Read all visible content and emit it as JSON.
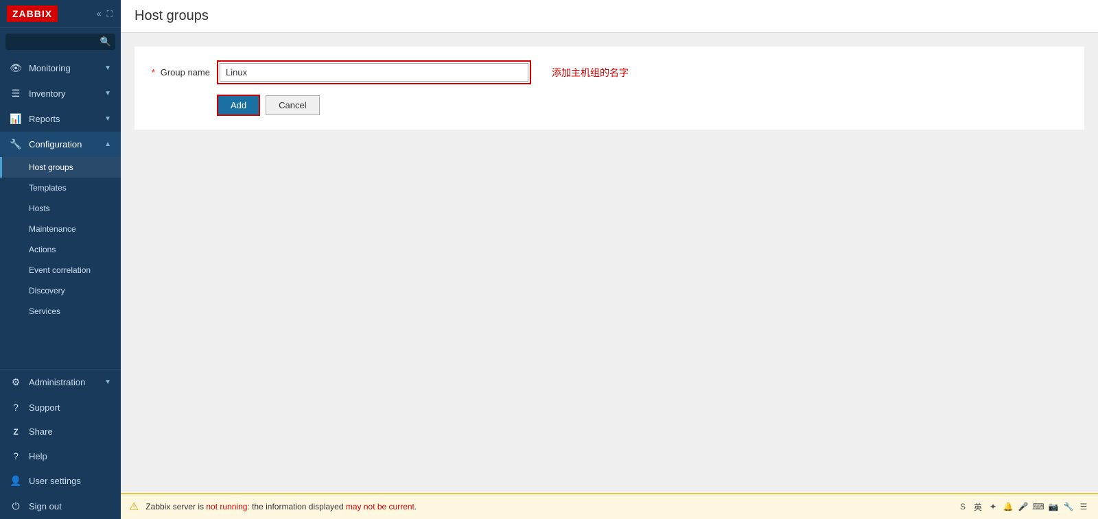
{
  "logo": {
    "text": "ZABBIX"
  },
  "search": {
    "placeholder": ""
  },
  "sidebar": {
    "nav_items": [
      {
        "id": "monitoring",
        "label": "Monitoring",
        "icon": "👁",
        "has_arrow": true
      },
      {
        "id": "inventory",
        "label": "Inventory",
        "icon": "☰",
        "has_arrow": true
      },
      {
        "id": "reports",
        "label": "Reports",
        "icon": "📊",
        "has_arrow": true
      },
      {
        "id": "configuration",
        "label": "Configuration",
        "icon": "🔧",
        "has_arrow": true,
        "active": true
      }
    ],
    "config_subitems": [
      {
        "id": "host-groups",
        "label": "Host groups",
        "active": true
      },
      {
        "id": "templates",
        "label": "Templates",
        "active": false
      },
      {
        "id": "hosts",
        "label": "Hosts",
        "active": false
      },
      {
        "id": "maintenance",
        "label": "Maintenance",
        "active": false
      },
      {
        "id": "actions",
        "label": "Actions",
        "active": false
      },
      {
        "id": "event-correlation",
        "label": "Event correlation",
        "active": false
      },
      {
        "id": "discovery",
        "label": "Discovery",
        "active": false
      },
      {
        "id": "services",
        "label": "Services",
        "active": false
      }
    ],
    "bottom_items": [
      {
        "id": "administration",
        "label": "Administration",
        "icon": "⚙",
        "has_arrow": true
      },
      {
        "id": "support",
        "label": "Support",
        "icon": "?"
      },
      {
        "id": "share",
        "label": "Share",
        "icon": "Z"
      },
      {
        "id": "help",
        "label": "Help",
        "icon": "?"
      },
      {
        "id": "user-settings",
        "label": "User settings",
        "icon": "👤"
      },
      {
        "id": "sign-out",
        "label": "Sign out",
        "icon": "⏻"
      }
    ]
  },
  "page": {
    "title": "Host groups"
  },
  "form": {
    "group_name_label": "Group name",
    "required_star": "*",
    "group_name_value": "Linux",
    "annotation": "添加主机组的名字",
    "add_button_label": "Add",
    "cancel_button_label": "Cancel"
  },
  "status_bar": {
    "warning_icon": "⚠",
    "message_prefix": "Zabbix server is ",
    "message_red": "not running",
    "message_suffix": ": the information displayed ",
    "message_red2": "may not be current",
    "message_end": "."
  }
}
